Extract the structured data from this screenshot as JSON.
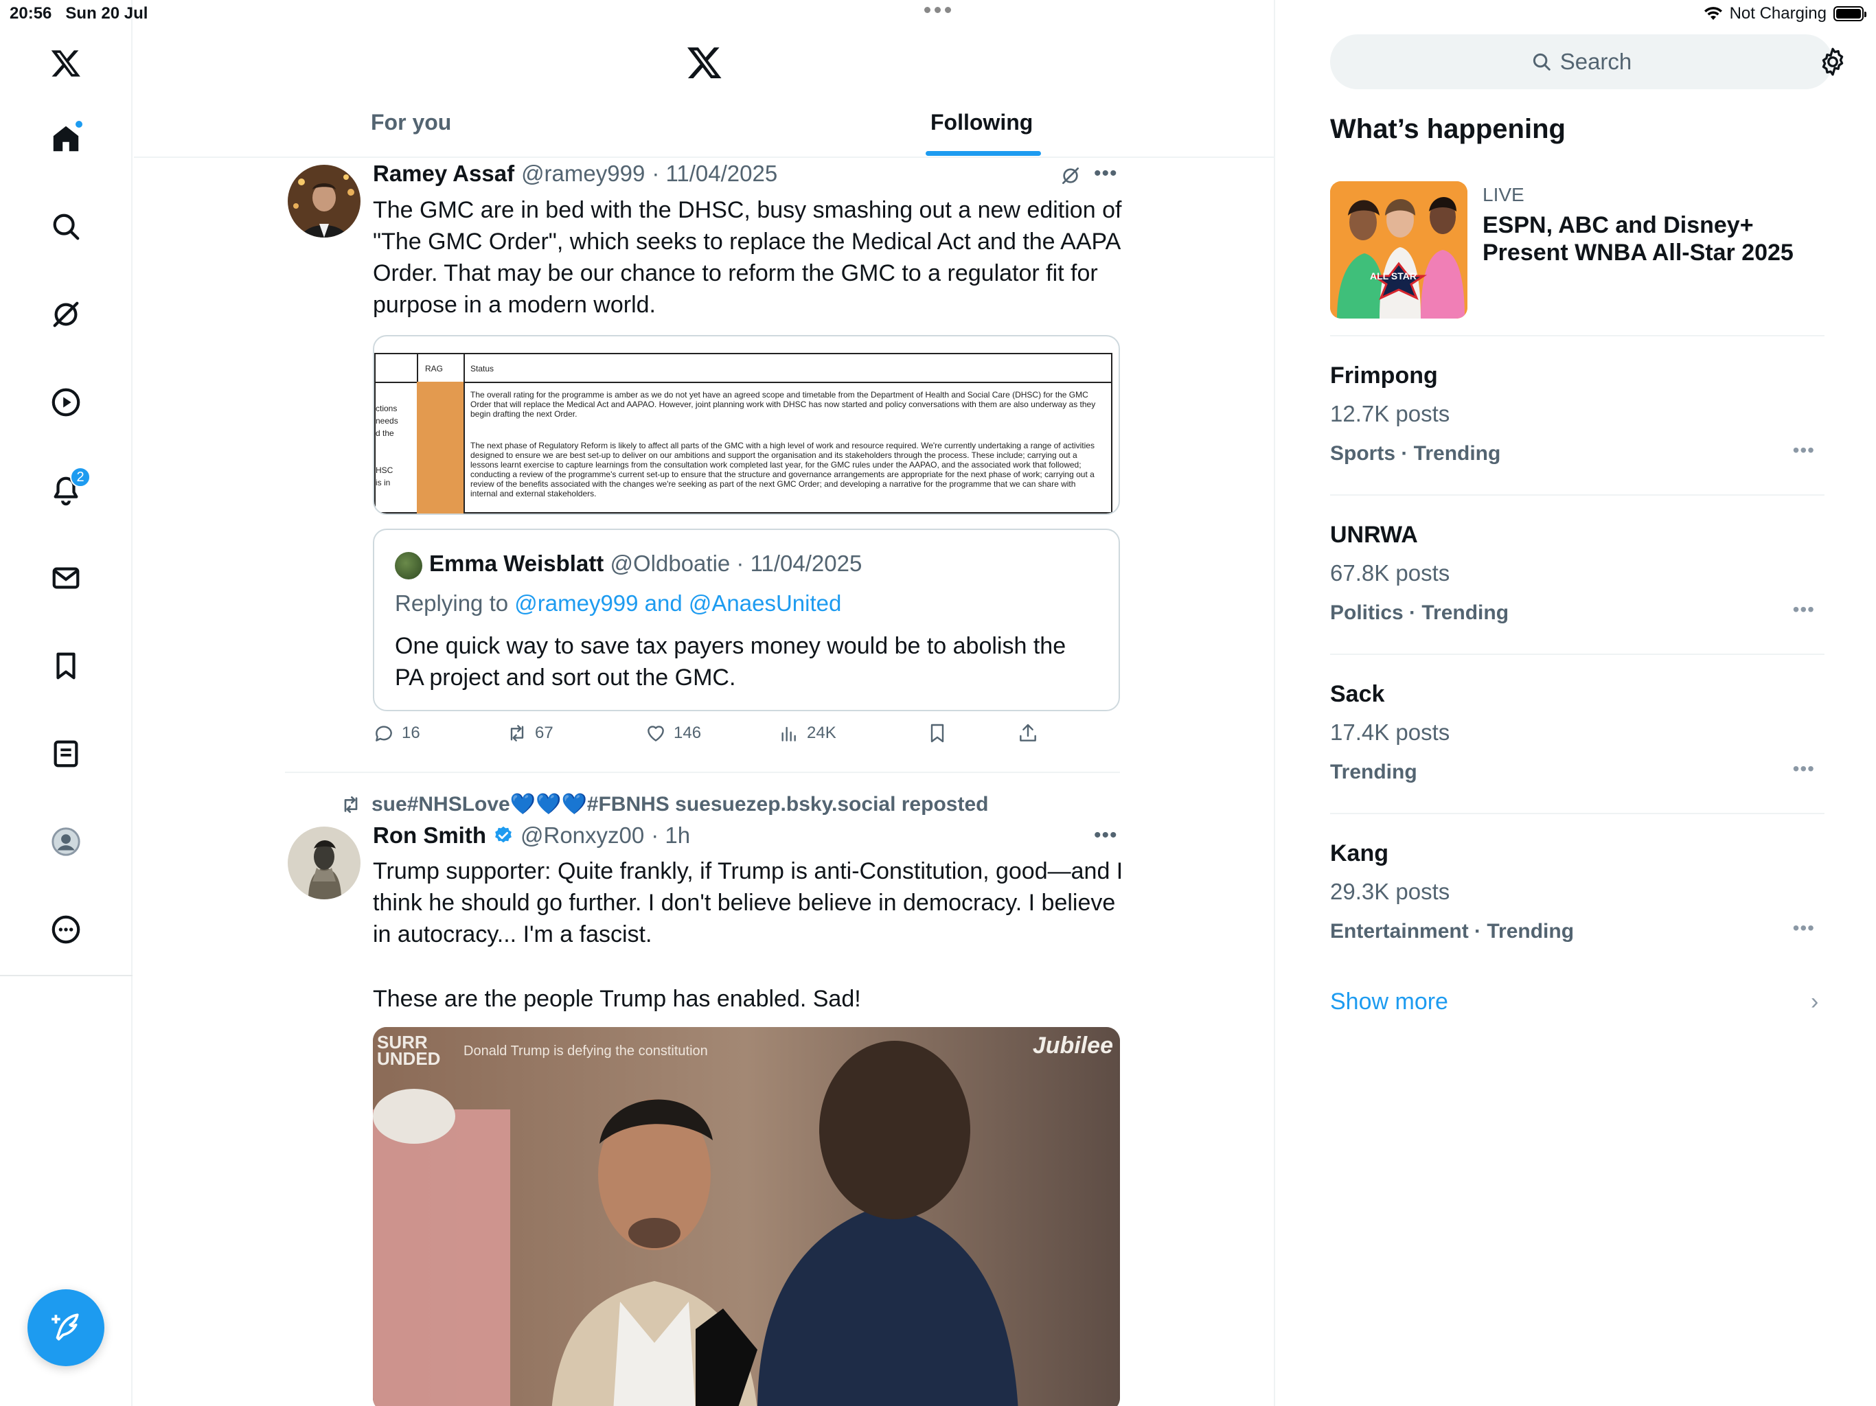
{
  "status_bar": {
    "time": "20:56",
    "date": "Sun 20 Jul",
    "charging": "Not Charging"
  },
  "nav": {
    "items": [
      "home-icon",
      "search-icon",
      "grok-icon",
      "video-icon",
      "notifications-icon",
      "messages-icon",
      "bookmarks-icon",
      "lists-icon",
      "profile-icon",
      "more-icon"
    ],
    "notifications_count": "2",
    "compose": "compose-icon"
  },
  "header": {
    "tabs": [
      {
        "label": "For you",
        "active": false
      },
      {
        "label": "Following",
        "active": true
      }
    ]
  },
  "tweets": [
    {
      "name": "Ramey Assaf",
      "handle": "@ramey999",
      "date": "· 11/04/2025",
      "text": "The GMC are in bed with the DHSC, busy smashing out a new edition of \"The GMC Order\", which seeks to replace the Medical Act and the AAPA Order. That may be our chance to reform the GMC to a regulator fit for purpose in a modern world.",
      "doc": {
        "col1": "RAG",
        "col2": "Status",
        "left_frag": [
          "ctions",
          "needs",
          "d the",
          "",
          "",
          "HSC",
          "is in"
        ],
        "para1": "The overall rating for the programme is amber as we do not yet have an agreed scope and timetable from the Department of Health and Social Care (DHSC) for the GMC Order that will replace the Medical Act and AAPAO. However, joint planning work with DHSC has now started and policy conversations with them are also underway as they begin drafting the next Order.",
        "para2": "The next phase of Regulatory Reform is likely to affect all parts of the GMC with a high level of work and resource required. We're currently undertaking a range of activities designed to ensure we are best set-up to deliver on our ambitions and support the organisation and its stakeholders through the process. These include; carrying out a lessons learnt exercise to capture learnings from the consultation work completed last year, for the GMC rules under the AAPAO, and the associated work that followed; conducting a review of the programme's current set-up to ensure that the structure and governance arrangements are appropriate for the next phase of work; carrying out a review of the benefits associated with the changes we're seeking as part of the next GMC Order; and developing a narrative for the programme that we can share with internal and external stakeholders."
      },
      "quote": {
        "name": "Emma Weisblatt",
        "handle": "@Oldboatie",
        "date": "· 11/04/2025",
        "replying_prefix": "Replying to ",
        "replying_to": "@ramey999 and @AnaesUnited",
        "text": "One quick way to save tax payers money would be to abolish the PA project and sort out the GMC."
      },
      "stats": {
        "replies": "16",
        "reposts": "67",
        "likes": "146",
        "views": "24K"
      }
    },
    {
      "reposted_by": "sue#NHSLove💙💙💙#FBNHS suesuezep.bsky.social reposted",
      "name": "Ron Smith",
      "handle": "@Ronxyz00",
      "date": "· 1h",
      "text1": "Trump supporter: Quite frankly, if Trump is anti-Constitution, good—and I think he should go further. I don't believe believe in democracy. I believe in autocracy... I'm a fascist.",
      "text2": "These are the people Trump has enabled. Sad!",
      "video": {
        "logo_left": "SURR\nUNDED",
        "caption": "Donald Trump is defying the constitution",
        "logo_right": "Jubilee"
      }
    }
  ],
  "sidebar": {
    "search_placeholder": "Search",
    "section_title": "What’s happening",
    "live": {
      "label": "LIVE",
      "title": "ESPN, ABC and Disney+ Present WNBA All-Star 2025",
      "badge": "ALL STAR"
    },
    "trends": [
      {
        "name": "Frimpong",
        "posts": "12.7K posts",
        "category": "Sports · Trending"
      },
      {
        "name": "UNRWA",
        "posts": "67.8K posts",
        "category": "Politics · Trending"
      },
      {
        "name": "Sack",
        "posts": "17.4K posts",
        "category": "Trending"
      },
      {
        "name": "Kang",
        "posts": "29.3K posts",
        "category": "Entertainment · Trending"
      }
    ],
    "show_more": "Show more"
  },
  "colors": {
    "accent": "#1d9bf0",
    "text": "#0f1419",
    "muted": "#536471",
    "border": "#eff3f4"
  }
}
